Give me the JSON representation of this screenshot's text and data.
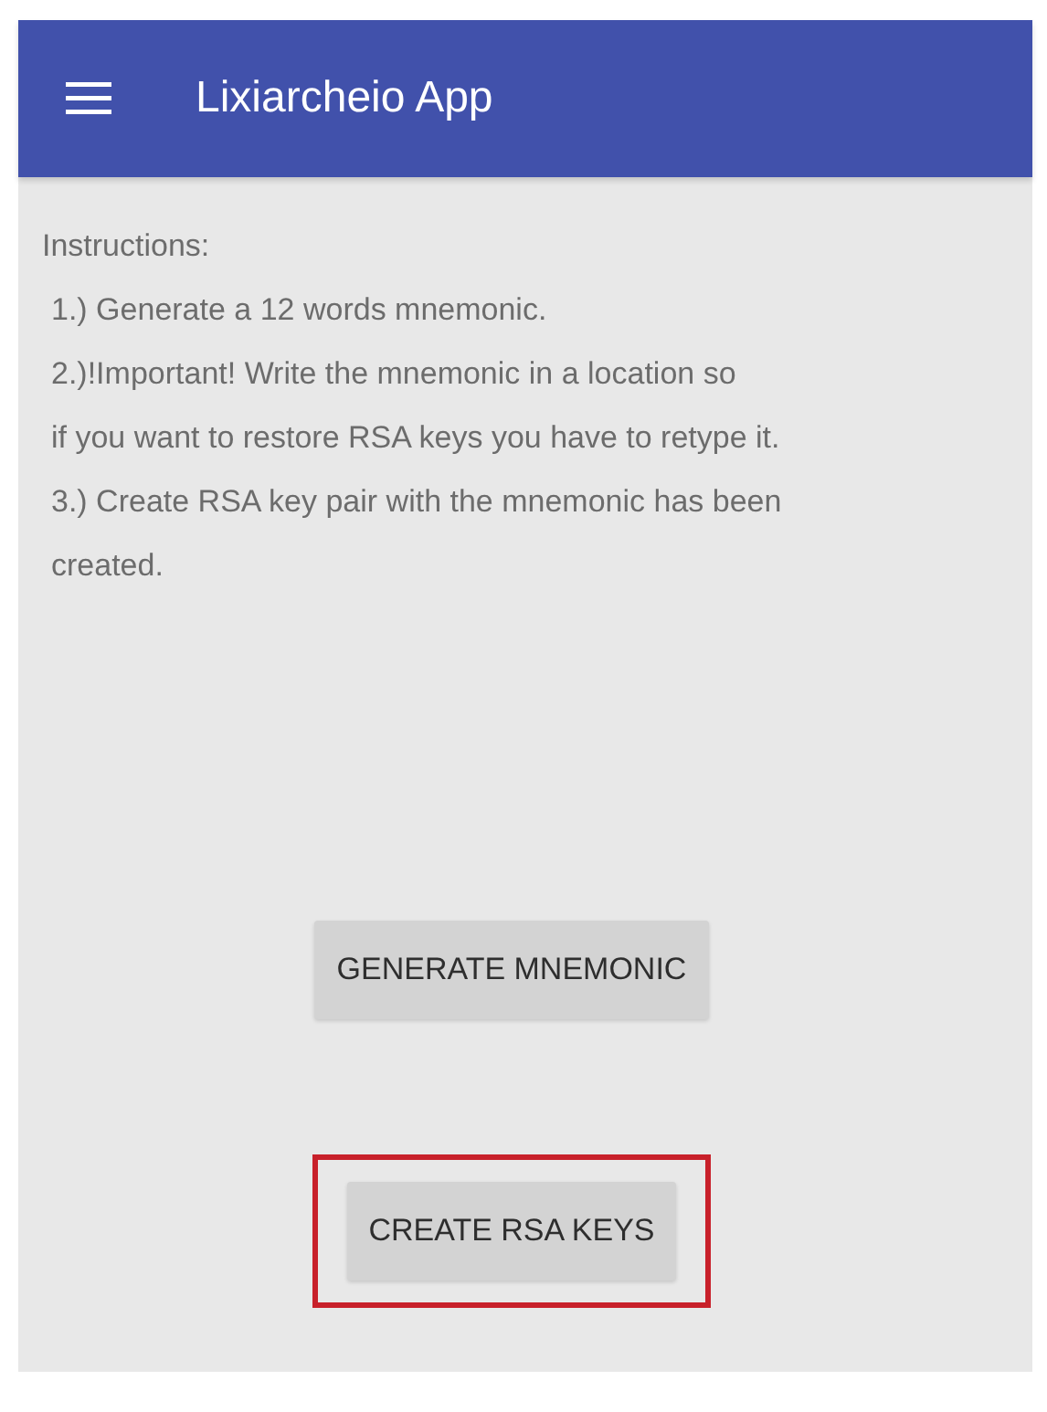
{
  "app_bar": {
    "title": "Lixiarcheio App"
  },
  "instructions": {
    "heading": "Instructions:",
    "lines": [
      "1.) Generate a 12 words mnemonic.",
      "2.)!Important! Write the mnemonic in a location so",
      "if you want to restore RSA keys you have to retype it.",
      "3.) Create RSA key pair with the mnemonic has been",
      "created."
    ]
  },
  "buttons": [
    {
      "label": "GENERATE MNEMONIC",
      "highlighted": false
    },
    {
      "label": "CREATE RSA KEYS",
      "highlighted": true
    }
  ]
}
